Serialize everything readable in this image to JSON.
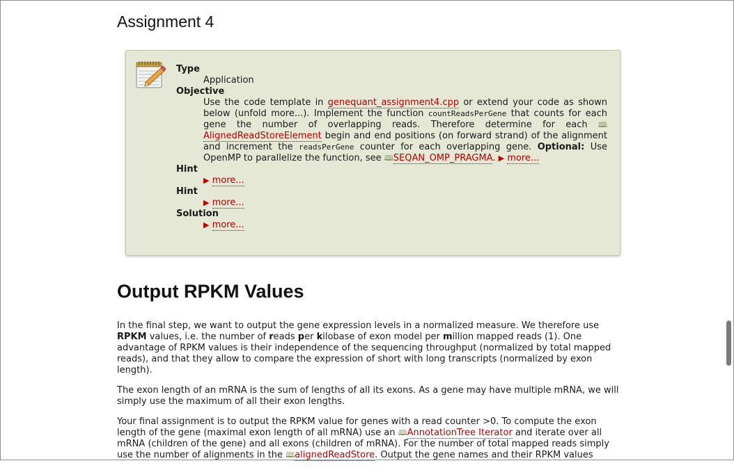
{
  "assignment": {
    "title": "Assignment 4",
    "type_label": "Type",
    "type_value": "Application",
    "objective_label": "Objective",
    "objective": {
      "t1": "Use the code template in ",
      "file_link": "genequant_assignment4.cpp",
      "t2": " or extend your code as shown below (unfold more...). Implement the function ",
      "func_code": "countReadsPerGene",
      "t3": " that counts for each gene the number of overlapping reads. Therefore determine for each ",
      "class_link": "AlignedReadStoreElement",
      "t4": " begin and end positions (on forward strand) of the alignment and increment the ",
      "counter_code": "readsPerGene",
      "t5": " counter for each overlapping gene. ",
      "optional_label": "Optional:",
      "t6": " Use OpenMP to parallelize the function, see ",
      "macro_link": "SEQAN_OMP_PRAGMA",
      "t7": ". "
    },
    "more_label": "more...",
    "hint1_label": "Hint",
    "hint2_label": "Hint",
    "solution_label": "Solution"
  },
  "section": {
    "title": "Output RPKM Values",
    "p1": {
      "t1": "In the final step, we want to output the gene expression levels in a normalized measure. We therefore use ",
      "rpkm": "RPKM",
      "t2": " values, i.e. the number of ",
      "r": "r",
      "t3": "eads ",
      "p": "p",
      "t4": "er ",
      "k": "k",
      "t5": "ilobase of exon model per ",
      "m": "m",
      "t6": "illion mapped reads (1). One advantage of RPKM values is their independence of the sequencing throughput (normalized by total mapped reads), and that they allow to compare the expression of short with long transcripts (normalized by exon length)."
    },
    "p2": "The exon length of an mRNA is the sum of lengths of all its exons. As a gene may have multiple mRNA, we will simply use the maximum of all their exon lengths.",
    "p3": {
      "t1": "Your final assignment is to output the RPKM value for genes with a read counter >0. To compute the exon length of the gene (maximal exon length of all mRNA) use an ",
      "link1": "AnnotationTree Iterator",
      "t2": " and iterate over all mRNA (children of the gene) and all exons (children of mRNA). For the number of total mapped reads simply use the number of alignments in the ",
      "link2": "alignedReadStore",
      "t3": ". Output the gene names and their RPKM values"
    }
  }
}
